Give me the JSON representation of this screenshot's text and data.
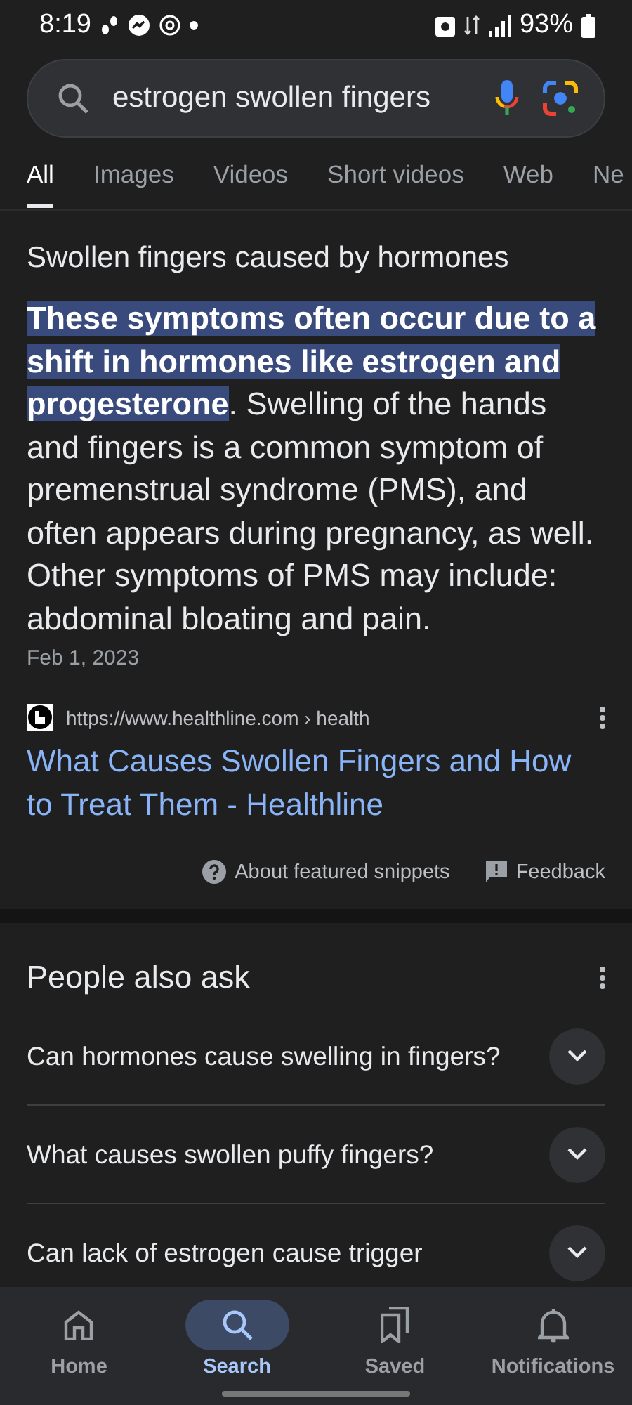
{
  "status_bar": {
    "time": "8:19",
    "battery": "93%"
  },
  "search": {
    "value": "estrogen swollen fingers"
  },
  "tabs": [
    {
      "label": "All",
      "selected": true
    },
    {
      "label": "Images",
      "selected": false
    },
    {
      "label": "Videos",
      "selected": false
    },
    {
      "label": "Short videos",
      "selected": false
    },
    {
      "label": "Web",
      "selected": false
    },
    {
      "label": "Ne",
      "selected": false
    }
  ],
  "featured_snippet": {
    "heading": "Swollen fingers caused by hormones",
    "highlighted": "These symptoms often occur due to a shift in hormones like estrogen and progesterone",
    "text": ". Swelling of the hands and fingers is a common symptom of premenstrual syndrome (PMS), and often appears during pregnancy, as well. Other symptoms of PMS may include: abdominal bloating and pain.",
    "date": "Feb 1, 2023",
    "source_url": "https://www.healthline.com",
    "source_path": "› health",
    "title": "What Causes Swollen Fingers and How to Treat Them - Healthline",
    "about": "About featured snippets",
    "feedback": "Feedback"
  },
  "people_also_ask": {
    "heading": "People also ask",
    "questions": [
      {
        "text": "Can hormones cause swelling in fingers?",
        "expanded": false
      },
      {
        "text": "What causes swollen puffy fingers?",
        "expanded": false
      },
      {
        "text": "Can lack of estrogen cause trigger",
        "expanded": false
      }
    ]
  },
  "bottom_nav": [
    {
      "label": "Home",
      "selected": false
    },
    {
      "label": "Search",
      "selected": true
    },
    {
      "label": "Saved",
      "selected": false
    },
    {
      "label": "Notifications",
      "selected": false
    }
  ]
}
